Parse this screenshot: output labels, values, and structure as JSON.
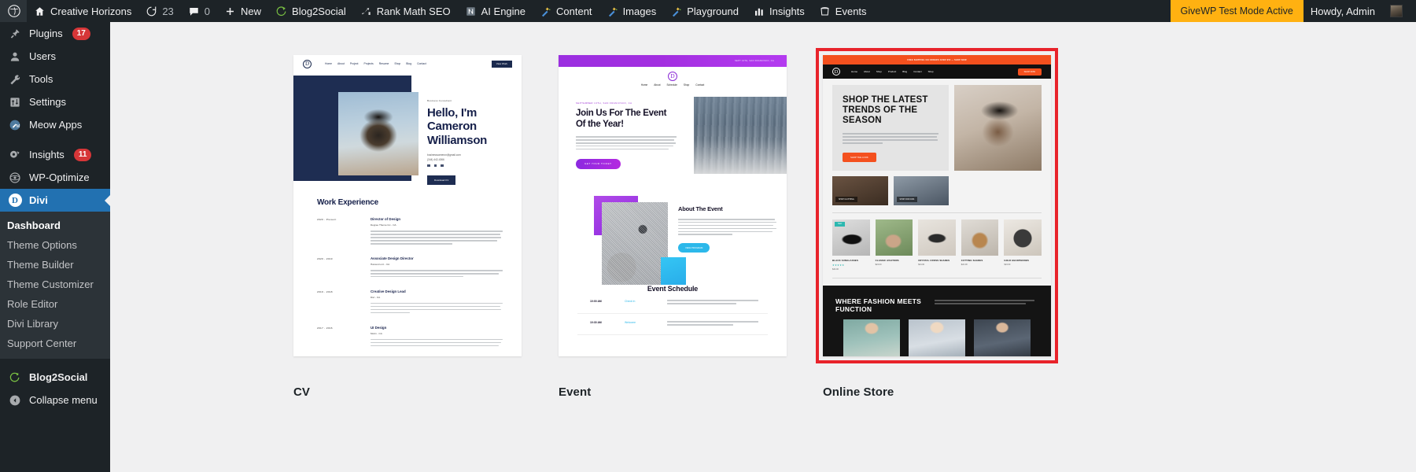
{
  "adminbar": {
    "logo_icon": "wordpress-logo-icon",
    "items": [
      {
        "icon": "home-icon",
        "label": "Creative Horizons",
        "name": "site-name"
      },
      {
        "icon": "updates-icon",
        "label": "23",
        "name": "updates"
      },
      {
        "icon": "comment-icon",
        "label": "0",
        "name": "comments"
      },
      {
        "icon": "plus-icon",
        "label": "New",
        "name": "new-content"
      },
      {
        "icon": "blog2social-icon",
        "label": "Blog2Social",
        "name": "blog2social"
      },
      {
        "icon": "rankmath-icon",
        "label": "Rank Math SEO",
        "name": "rank-math-seo"
      },
      {
        "icon": "ai-engine-icon",
        "label": "AI Engine",
        "name": "ai-engine"
      },
      {
        "icon": "magic-wand-icon",
        "label": "Content",
        "name": "content"
      },
      {
        "icon": "magic-wand-icon",
        "label": "Images",
        "name": "images"
      },
      {
        "icon": "magic-wand-icon",
        "label": "Playground",
        "name": "playground"
      },
      {
        "icon": "bar-chart-icon",
        "label": "Insights",
        "name": "insights"
      },
      {
        "icon": "events-icon",
        "label": "Events",
        "name": "events"
      }
    ],
    "givewp_notice": "GiveWP Test Mode Active",
    "howdy": "Howdy, Admin",
    "givewp_bg": "#ffb111"
  },
  "sidebar": {
    "items": [
      {
        "label": "Plugins",
        "icon": "plugins-icon",
        "badge": "17"
      },
      {
        "label": "Users",
        "icon": "users-icon",
        "badge": ""
      },
      {
        "label": "Tools",
        "icon": "tools-icon",
        "badge": ""
      },
      {
        "label": "Settings",
        "icon": "settings-icon",
        "badge": ""
      },
      {
        "label": "Meow Apps",
        "icon": "meow-apps-icon",
        "badge": ""
      },
      {
        "label": "Insights",
        "icon": "insights-icon",
        "badge": "11"
      },
      {
        "label": "WP-Optimize",
        "icon": "wp-optimize-icon",
        "badge": ""
      }
    ],
    "current": {
      "label": "Divi",
      "icon": "divi-icon",
      "letter": "D"
    },
    "submenu": [
      {
        "label": "Dashboard",
        "current": true
      },
      {
        "label": "Theme Options",
        "current": false
      },
      {
        "label": "Theme Builder",
        "current": false
      },
      {
        "label": "Theme Customizer",
        "current": false
      },
      {
        "label": "Role Editor",
        "current": false
      },
      {
        "label": "Divi Library",
        "current": false
      },
      {
        "label": "Support Center",
        "current": false
      }
    ],
    "blog2social": {
      "label": "Blog2Social",
      "icon": "blog2social-icon"
    },
    "collapse": {
      "label": "Collapse menu",
      "icon": "collapse-arrow-icon"
    },
    "accent": "#2271b1",
    "badge_color": "#d63638"
  },
  "templates": {
    "selection_color": "#e8232b",
    "cards": [
      {
        "label": "CV",
        "selected": false
      },
      {
        "label": "Event",
        "selected": false
      },
      {
        "label": "Online Store",
        "selected": true
      }
    ]
  },
  "cv_preview": {
    "logo": "D",
    "nav": [
      "Home",
      "About",
      "Project",
      "Projects",
      "Resume",
      "Shop",
      "Blog",
      "Contact"
    ],
    "nav_button": "View Work",
    "eyebrow": "Business Consultant",
    "heading": "Hello, I'm Cameron Williamson",
    "email": "businesscameron@gmail.com",
    "phone": "(344) 442-4366",
    "cta": "Download CV",
    "section_title": "Work Experience",
    "jobs": [
      {
        "dates": "2020 - Present",
        "title": "Director of Design",
        "company": "Degree Theme Inc - CA",
        "lines": 5
      },
      {
        "dates": "2020 - 2019",
        "title": "Associate Design Director",
        "company": "Harvest LLC - CA",
        "lines": 3
      },
      {
        "dates": "2019 - 2018",
        "title": "Creative Design Lead",
        "company": "Divi - CA",
        "lines": 4
      },
      {
        "dates": "2017 - 2016",
        "title": "UI Design",
        "company": "Morin - CA",
        "lines": 3
      }
    ]
  },
  "event_preview": {
    "logo": "D",
    "topbar": "SEPT 13TH, SAN FRANCISCO, CA",
    "nav": [
      "Home",
      "About",
      "Schedule",
      "Shop",
      "Contact"
    ],
    "eyebrow": "SEPTEMBER 13TH, SAN FRANCISCO, CA",
    "heading": "Join Us For The Event Of the Year!",
    "cta": "GET YOUR TICKET",
    "about_title": "About The Event",
    "about_cta": "VIEW PROGRAM",
    "schedule_title": "Event Schedule",
    "schedule": [
      {
        "time": "10:00 AM",
        "name": "Check In",
        "lines": 2
      },
      {
        "time": "10:30 AM",
        "name": "Welcome",
        "lines": 2
      }
    ]
  },
  "store_preview": {
    "logo": "D",
    "promo": "FREE SHIPPING ON ORDERS OVER $50 — SHOP NOW",
    "nav": [
      "Home",
      "About",
      "Shop",
      "Product",
      "Blog",
      "Contact",
      "Shop"
    ],
    "nav_button": "SHOP NOW",
    "heading": "SHOP THE LATEST TRENDS OF THE SEASON",
    "cta": "SHOP THE LOOK",
    "tiles": [
      {
        "label": "SHOP CLOTHING"
      },
      {
        "label": "SHOP FOR KIDS"
      }
    ],
    "products": [
      {
        "name": "BLACK SUNGLASSES",
        "price": "$24.00",
        "sale": "Sale!",
        "stars": "★★★★★"
      },
      {
        "name": "CLASSIC AVIATORS",
        "price": "$24.00",
        "sale": "",
        "stars": ""
      },
      {
        "name": "CRYSTAL CROSS SHADES",
        "price": "$24.00",
        "sale": "",
        "stars": ""
      },
      {
        "name": "CUTTING SHADES",
        "price": "$24.00",
        "sale": "",
        "stars": ""
      },
      {
        "name": "GOLD HEADPHONES",
        "price": "$24.00",
        "sale": "",
        "stars": ""
      }
    ],
    "dark_heading": "WHERE FASHION MEETS FUNCTION"
  }
}
